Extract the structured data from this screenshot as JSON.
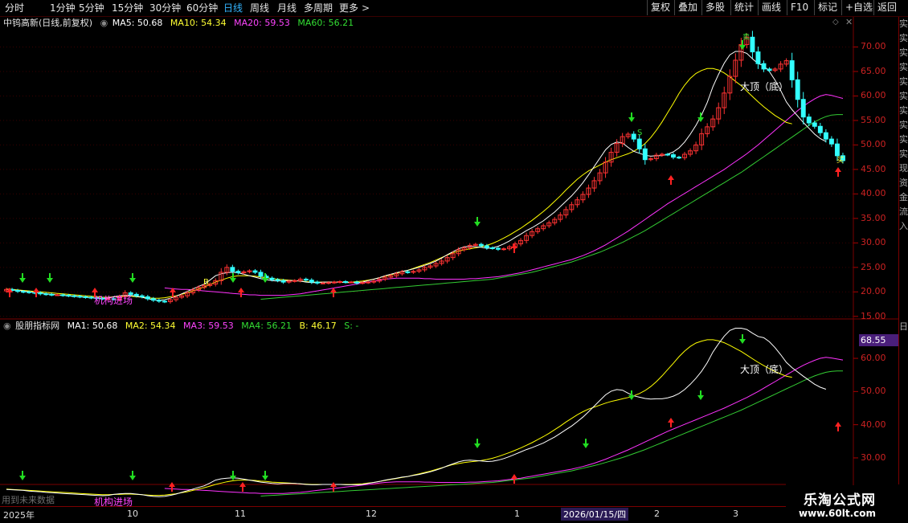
{
  "toolbar": {
    "periods": [
      "分时",
      "1分钟",
      "5分钟",
      "15分钟",
      "30分钟",
      "60分钟",
      "日线",
      "周线",
      "月线",
      "多周期",
      "更多"
    ],
    "active_period": "日线",
    "more_arrow": ">",
    "right_buttons": [
      "复权",
      "叠加",
      "多股",
      "统计",
      "画线",
      "F10",
      "标记",
      "+自选",
      "返回"
    ]
  },
  "main_legend": {
    "stock": "中钨高新(日线,前复权)",
    "ma5": "MA5: 50.68",
    "ma10": "MA10: 54.34",
    "ma20": "MA20: 59.53",
    "ma60": "MA60: 56.21"
  },
  "sub_legend": {
    "name": "股朋指标网",
    "ma1": "MA1: 50.68",
    "ma2": "MA2: 54.34",
    "ma3": "MA3: 59.53",
    "ma4": "MA4: 56.21",
    "b": "B: 46.17",
    "s": "S: -"
  },
  "main_axis": [
    "70.00",
    "65.00",
    "60.00",
    "55.00",
    "50.00",
    "45.00",
    "40.00",
    "35.00",
    "30.00",
    "25.00",
    "20.00",
    "15.00"
  ],
  "sub_axis": [
    "60.00",
    "50.00",
    "40.00",
    "30.00"
  ],
  "sub_current_value": "68.55",
  "annotations": {
    "top_main": "大顶（底）",
    "top_sub": "大顶（底）",
    "inst_main": "机构进场",
    "inst_sub": "机构进场",
    "sell": "卖",
    "buy": "买",
    "b_mark": "B",
    "s_mark": "S",
    "use_history": "用到未来数据"
  },
  "date_axis": {
    "labels": [
      "2025年",
      "10",
      "11",
      "12",
      "1",
      "2",
      "3"
    ],
    "selected_date": "2026/01/15/四"
  },
  "side_strip_text": "实实实实实实实实实实现资金流入",
  "side_strip_sub": "日",
  "brand": {
    "name": "乐淘公式网",
    "url": "www.60lt.com"
  },
  "colors": {
    "up": "#ff3333",
    "down": "#33ffff",
    "ma5": "#ffffff",
    "ma10": "#ffff00",
    "ma20": "#ff33ff",
    "ma60": "#33cc33",
    "grid": "#7a0000",
    "active": "#33b5ff"
  },
  "chart_data": {
    "type": "candlestick",
    "y_range": [
      13,
      75
    ],
    "closes": [
      20.5,
      20.3,
      20.1,
      20.0,
      19.9,
      19.8,
      19.6,
      19.5,
      19.4,
      19.4,
      19.3,
      19.2,
      19.1,
      19.0,
      18.9,
      18.8,
      18.7,
      18.6,
      18.6,
      18.5,
      19.0,
      19.8,
      19.5,
      19.2,
      19.0,
      18.6,
      18.3,
      18.1,
      18.0,
      18.4,
      18.9,
      19.2,
      19.8,
      20.4,
      20.9,
      21.3,
      21.6,
      22.3,
      24.0,
      25.0,
      24.2,
      23.9,
      24.1,
      24.3,
      24.0,
      23.2,
      22.8,
      22.5,
      22.3,
      22.0,
      22.2,
      22.3,
      22.6,
      22.4,
      22.0,
      21.8,
      21.8,
      21.9,
      22.0,
      22.1,
      22.0,
      22.0,
      21.8,
      21.9,
      22.0,
      22.2,
      22.6,
      23.0,
      23.3,
      23.7,
      24.1,
      24.0,
      24.2,
      24.5,
      25.0,
      25.3,
      25.8,
      26.3,
      27.0,
      27.8,
      28.6,
      29.0,
      29.5,
      29.7,
      29.4,
      29.0,
      28.9,
      28.7,
      28.8,
      29.2,
      29.8,
      30.5,
      31.5,
      32.3,
      32.9,
      33.5,
      34.1,
      34.8,
      35.7,
      36.8,
      37.8,
      38.8,
      39.9,
      41.2,
      42.7,
      44.3,
      46.5,
      48.5,
      50.3,
      51.7,
      52.2,
      51.2,
      49.2,
      47.0,
      47.2,
      47.9,
      48.1,
      48.0,
      47.5,
      47.4,
      48.1,
      48.8,
      50.0,
      52.3,
      53.7,
      55.3,
      57.6,
      60.6,
      64.0,
      67.3,
      70.5,
      72.0,
      69.0,
      66.6,
      65.5,
      65.2,
      65.5,
      66.5,
      67.2,
      63.3,
      59.3,
      55.7,
      54.5,
      53.8,
      52.5,
      51.2,
      50.2,
      47.8,
      46.8
    ],
    "ma5": [
      20.5,
      20.4,
      20.3,
      20.2,
      20.0,
      19.9,
      19.8,
      19.6,
      19.5,
      19.4,
      19.3,
      19.2,
      19.1,
      19.0,
      18.9,
      18.8,
      18.7,
      18.6,
      18.7,
      19.0,
      19.2,
      19.3,
      19.3,
      19.1,
      18.9,
      18.6,
      18.4,
      18.3,
      18.4,
      18.7,
      19.1,
      19.6,
      20.1,
      20.6,
      21.1,
      21.6,
      22.4,
      23.3,
      23.7,
      23.9,
      24.0,
      23.9,
      23.6,
      23.3,
      23.0,
      22.7,
      22.5,
      22.3,
      22.2,
      22.3,
      22.3,
      22.3,
      22.2,
      22.0,
      21.9,
      21.9,
      22.0,
      22.0,
      22.0,
      22.0,
      21.9,
      21.9,
      21.9,
      22.0,
      22.3,
      22.6,
      22.9,
      23.3,
      23.6,
      23.9,
      24.2,
      24.4,
      24.7,
      25.0,
      25.4,
      25.8,
      26.3,
      26.9,
      27.6,
      28.2,
      28.8,
      29.2,
      29.3,
      29.2,
      29.1,
      28.9,
      29.0,
      29.3,
      29.8,
      30.4,
      31.1,
      31.8,
      32.5,
      33.1,
      33.8,
      34.5,
      35.4,
      36.3,
      37.4,
      38.5,
      39.6,
      40.9,
      42.3,
      43.9,
      45.6,
      47.3,
      49.0,
      50.1,
      50.6,
      50.4,
      49.5,
      48.7,
      48.3,
      47.9,
      47.7,
      47.8,
      47.8,
      48.1,
      48.6,
      49.4,
      50.6,
      52.2,
      54.0,
      56.1,
      58.7,
      61.9,
      64.4,
      66.7,
      68.4,
      69.1,
      69.1,
      68.7,
      67.6,
      66.6,
      66.2,
      65.0,
      63.2,
      61.1,
      58.8,
      57.2,
      55.9,
      54.6,
      53.4,
      52.2,
      51.3,
      50.7
    ],
    "ma10": [
      20.6,
      20.5,
      20.4,
      20.3,
      20.2,
      20.1,
      20.0,
      19.9,
      19.8,
      19.7,
      19.6,
      19.5,
      19.4,
      19.3,
      19.2,
      19.1,
      19.0,
      18.9,
      18.9,
      19.0,
      19.0,
      19.1,
      19.1,
      19.0,
      18.9,
      18.8,
      18.7,
      18.7,
      18.8,
      19.0,
      19.2,
      19.5,
      19.8,
      20.2,
      20.6,
      21.0,
      21.5,
      22.0,
      22.4,
      22.8,
      23.1,
      23.3,
      23.3,
      23.3,
      23.2,
      23.0,
      22.9,
      22.7,
      22.6,
      22.5,
      22.4,
      22.3,
      22.2,
      22.1,
      22.0,
      22.0,
      22.0,
      22.0,
      22.0,
      22.0,
      22.0,
      22.0,
      22.1,
      22.2,
      22.4,
      22.6,
      22.9,
      23.2,
      23.5,
      23.8,
      24.1,
      24.4,
      24.8,
      25.2,
      25.6,
      26.0,
      26.5,
      27.0,
      27.5,
      28.0,
      28.3,
      28.6,
      28.8,
      29.0,
      29.2,
      29.5,
      29.9,
      30.4,
      31.0,
      31.6,
      32.3,
      33.0,
      33.8,
      34.6,
      35.5,
      36.4,
      37.4,
      38.5,
      39.6,
      40.8,
      41.9,
      43.0,
      43.9,
      44.7,
      45.3,
      45.9,
      46.5,
      47.0,
      47.4,
      47.8,
      48.2,
      48.7,
      49.4,
      50.3,
      51.5,
      53.0,
      54.7,
      56.6,
      58.5,
      60.5,
      62.2,
      63.6,
      64.6,
      65.2,
      65.6,
      65.6,
      65.3,
      64.7,
      63.9,
      63.0,
      62.1,
      61.0,
      59.9,
      58.8,
      57.8,
      56.9,
      56.0,
      55.3,
      54.6,
      54.3
    ],
    "ma20": [
      20.8,
      20.7,
      20.6,
      20.5,
      20.5,
      20.4,
      20.3,
      20.2,
      20.1,
      20.0,
      19.9,
      19.8,
      19.7,
      19.6,
      19.5,
      19.4,
      19.4,
      19.3,
      19.3,
      19.3,
      19.3,
      19.3,
      19.4,
      19.5,
      19.6,
      19.8,
      20.0,
      20.2,
      20.4,
      20.6,
      20.8,
      21.0,
      21.2,
      21.4,
      21.6,
      21.8,
      22.0,
      22.2,
      22.4,
      22.6,
      22.7,
      22.8,
      22.8,
      22.8,
      22.8,
      22.8,
      22.7,
      22.7,
      22.6,
      22.6,
      22.6,
      22.6,
      22.6,
      22.6,
      22.7,
      22.7,
      22.8,
      22.9,
      23.0,
      23.1,
      23.3,
      23.5,
      23.7,
      23.9,
      24.2,
      24.5,
      24.8,
      25.1,
      25.4,
      25.7,
      26.0,
      26.3,
      26.6,
      27.0,
      27.4,
      27.9,
      28.4,
      29.0,
      29.6,
      30.3,
      31.0,
      31.7,
      32.4,
      33.2,
      34.0,
      34.8,
      35.6,
      36.4,
      37.2,
      38.0,
      38.7,
      39.4,
      40.1,
      40.8,
      41.5,
      42.2,
      42.9,
      43.6,
      44.3,
      45.0,
      45.8,
      46.6,
      47.4,
      48.2,
      49.1,
      50.0,
      51.0,
      52.0,
      53.0,
      54.0,
      55.0,
      56.0,
      57.0,
      57.9,
      58.7,
      59.4,
      60.0,
      60.3,
      60.1,
      59.8,
      59.5
    ],
    "ma60": [
      18.5,
      18.6,
      18.7,
      18.8,
      18.9,
      19.0,
      19.1,
      19.2,
      19.3,
      19.4,
      19.5,
      19.6,
      19.7,
      19.8,
      19.9,
      20.0,
      20.1,
      20.2,
      20.3,
      20.4,
      20.5,
      20.6,
      20.7,
      20.8,
      20.9,
      21.0,
      21.1,
      21.2,
      21.3,
      21.4,
      21.5,
      21.6,
      21.7,
      21.8,
      21.9,
      22.0,
      22.1,
      22.2,
      22.3,
      22.4,
      22.5,
      22.6,
      22.8,
      23.0,
      23.2,
      23.4,
      23.6,
      23.8,
      24.0,
      24.3,
      24.6,
      24.9,
      25.2,
      25.5,
      25.8,
      26.1,
      26.5,
      26.9,
      27.3,
      27.7,
      28.1,
      28.6,
      29.1,
      29.6,
      30.1,
      30.7,
      31.3,
      31.9,
      32.5,
      33.2,
      33.9,
      34.6,
      35.3,
      36.0,
      36.7,
      37.4,
      38.1,
      38.8,
      39.5,
      40.2,
      40.9,
      41.6,
      42.3,
      43.0,
      43.7,
      44.4,
      45.2,
      46.0,
      46.8,
      47.6,
      48.4,
      49.2,
      50.0,
      50.8,
      51.6,
      52.4,
      53.2,
      54.0,
      54.7,
      55.3,
      55.8,
      56.1,
      56.2,
      56.2
    ]
  }
}
